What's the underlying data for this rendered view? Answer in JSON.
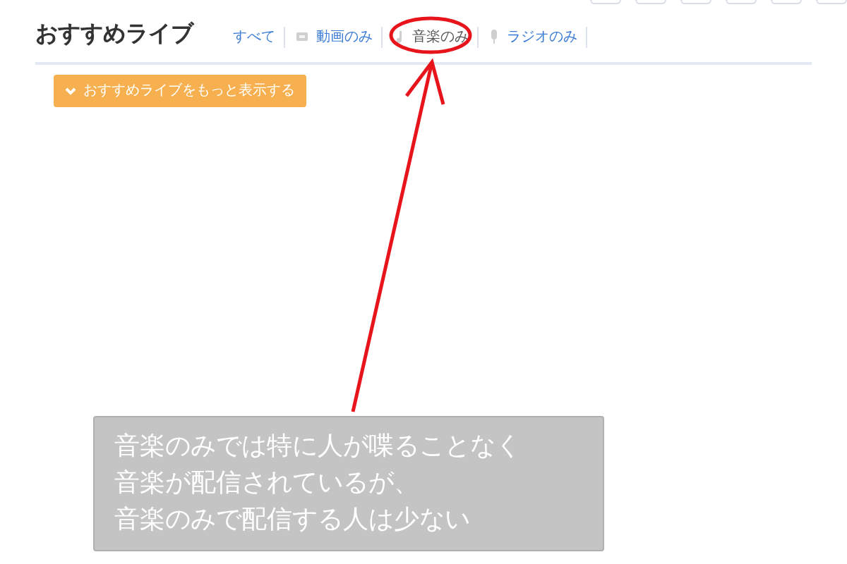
{
  "section": {
    "title": "おすすめライブ"
  },
  "filters": [
    {
      "label": "すべて",
      "kind": "plain",
      "selected": false
    },
    {
      "label": "動画のみ",
      "kind": "video",
      "selected": false
    },
    {
      "label": "音楽のみ",
      "kind": "music",
      "selected": true
    },
    {
      "label": "ラジオのみ",
      "kind": "radio",
      "selected": false
    }
  ],
  "more_button": {
    "label": "おすすめライブをもっと表示する"
  },
  "annotation": {
    "lines": [
      "音楽のみでは特に人が喋ることなく",
      "音楽が配信されているが、",
      "音楽のみで配信する人は少ない"
    ]
  }
}
